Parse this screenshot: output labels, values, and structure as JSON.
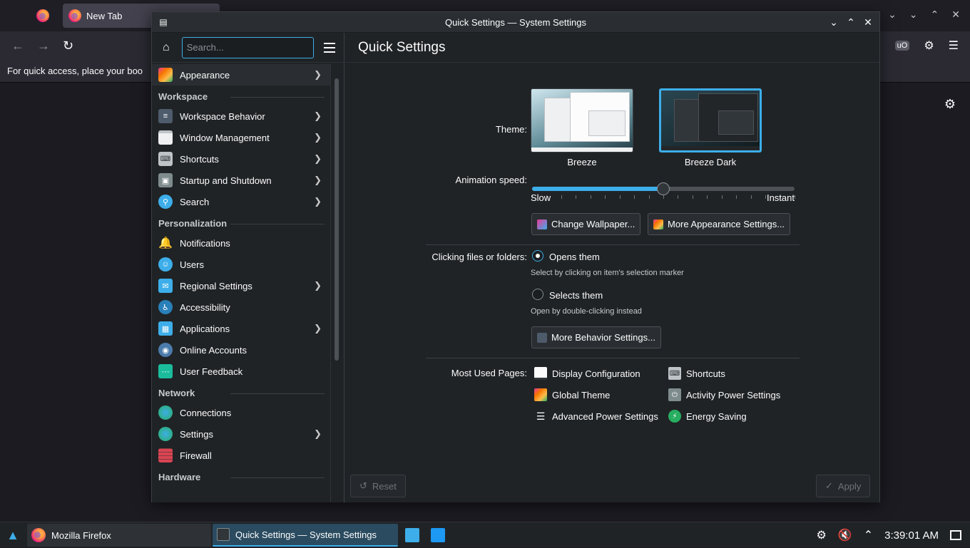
{
  "firefox": {
    "tab_title": "New Tab",
    "bookmarks_hint": "For quick access, place your boo",
    "icons": [
      "back-icon",
      "forward-icon",
      "reload-icon",
      "ublock-icon",
      "extensions-icon",
      "menu-icon",
      "settings-gear-icon"
    ]
  },
  "window": {
    "title": "Quick Settings — System Settings",
    "controls": [
      "minimize-icon",
      "maximize-icon",
      "close-icon"
    ]
  },
  "sidebar": {
    "search_placeholder": "Search...",
    "top_item": {
      "label": "Appearance",
      "has_chevron": true
    },
    "sections": [
      {
        "title": "Workspace",
        "items": [
          {
            "label": "Workspace Behavior",
            "has_chevron": true
          },
          {
            "label": "Window Management",
            "has_chevron": true
          },
          {
            "label": "Shortcuts",
            "has_chevron": true
          },
          {
            "label": "Startup and Shutdown",
            "has_chevron": true
          },
          {
            "label": "Search",
            "has_chevron": true
          }
        ]
      },
      {
        "title": "Personalization",
        "items": [
          {
            "label": "Notifications",
            "has_chevron": false
          },
          {
            "label": "Users",
            "has_chevron": false
          },
          {
            "label": "Regional Settings",
            "has_chevron": true
          },
          {
            "label": "Accessibility",
            "has_chevron": false
          },
          {
            "label": "Applications",
            "has_chevron": true
          },
          {
            "label": "Online Accounts",
            "has_chevron": false
          },
          {
            "label": "User Feedback",
            "has_chevron": false
          }
        ]
      },
      {
        "title": "Network",
        "items": [
          {
            "label": "Connections",
            "has_chevron": false
          },
          {
            "label": "Settings",
            "has_chevron": true
          },
          {
            "label": "Firewall",
            "has_chevron": false
          }
        ]
      },
      {
        "title": "Hardware",
        "items": []
      }
    ]
  },
  "main": {
    "heading": "Quick Settings",
    "theme_label": "Theme:",
    "themes": [
      {
        "name": "Breeze",
        "selected": false
      },
      {
        "name": "Breeze Dark",
        "selected": true
      }
    ],
    "animation_label": "Animation speed:",
    "animation_value": 0.5,
    "slow_label": "Slow",
    "instant_label": "Instant",
    "change_wallpaper": "Change Wallpaper...",
    "more_appearance": "More Appearance Settings...",
    "clicking_label": "Clicking files or folders:",
    "opens_them": "Opens them",
    "opens_hint": "Select by clicking on item's selection marker",
    "selects_them": "Selects them",
    "selects_hint": "Open by double-clicking instead",
    "more_behavior": "More Behavior Settings...",
    "most_used_label": "Most Used Pages:",
    "most_used": [
      "Display Configuration",
      "Shortcuts",
      "Global Theme",
      "Activity Power Settings",
      "Advanced Power Settings",
      "Energy Saving"
    ],
    "reset": "Reset",
    "apply": "Apply"
  },
  "taskbar": {
    "firefox_task": "Mozilla Firefox",
    "settings_task": "Quick Settings  — System Settings",
    "clock": "3:39:01 AM"
  }
}
